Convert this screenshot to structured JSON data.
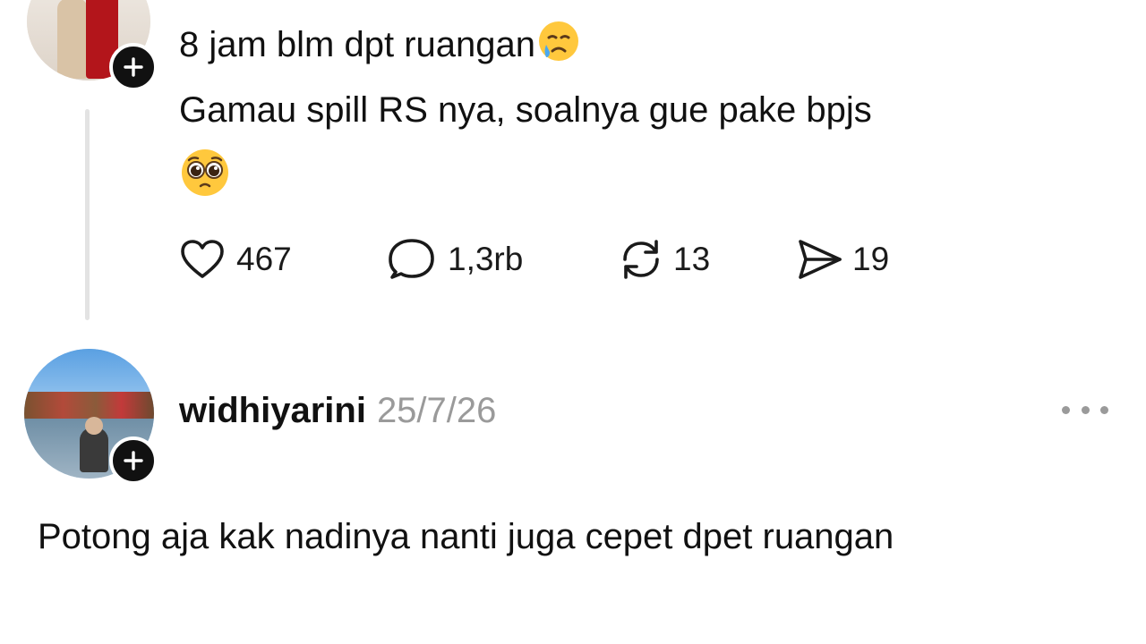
{
  "post1": {
    "line1": "8 jam blm dpt ruangan",
    "line1_emoji": "crying-face-emoji",
    "line2": "Gamau spill RS nya, soalnya gue pake bpjs",
    "line3_emoji": "pleading-face-emoji",
    "actions": {
      "likes": "467",
      "comments": "1,3rb",
      "reposts": "13",
      "shares": "19"
    }
  },
  "post2": {
    "username": "widhiyarini",
    "timestamp": "25/7/26",
    "text": "Potong aja kak nadinya nanti juga cepet dpet ruangan"
  },
  "colors": {
    "text": "#111111",
    "muted": "#9a9a9a",
    "thread_line": "#e3e3e3",
    "badge": "#111111"
  }
}
